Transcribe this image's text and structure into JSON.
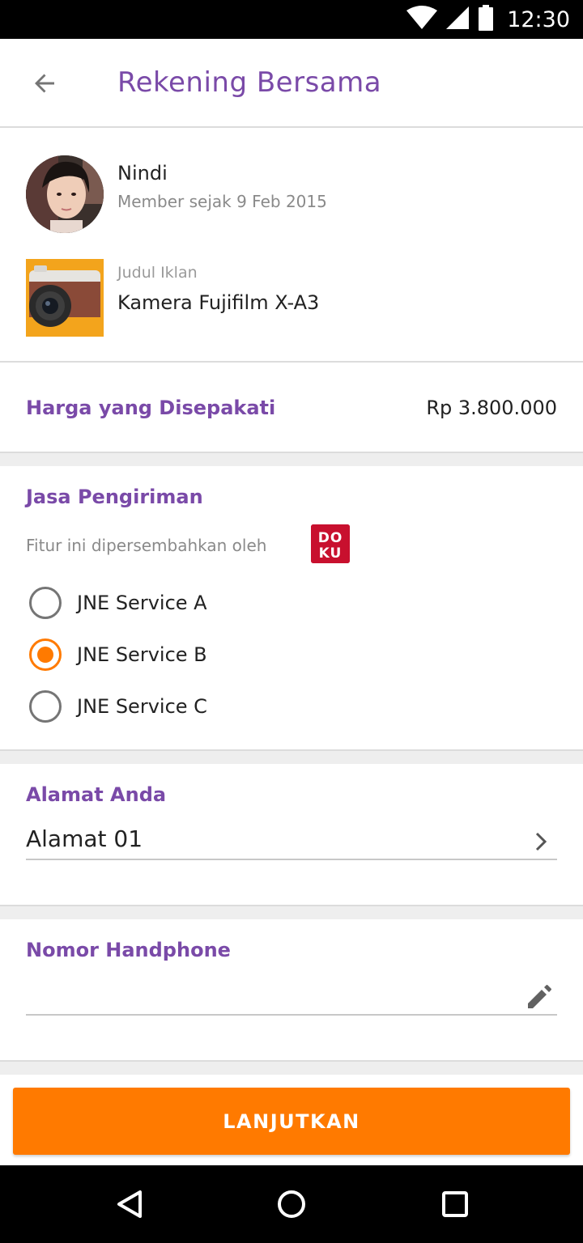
{
  "status_bar": {
    "time": "12:30"
  },
  "app_bar": {
    "title": "Rekening Bersama"
  },
  "seller": {
    "name": "Nindi",
    "member_since": "Member sejak 9 Feb 2015"
  },
  "ad": {
    "label": "Judul Iklan",
    "title": "Kamera Fujifilm X-A3"
  },
  "price": {
    "label": "Harga yang Disepakati",
    "value": "Rp 3.800.000"
  },
  "shipping": {
    "title": "Jasa Pengiriman",
    "powered_by": "Fitur ini dipersembahkan oleh",
    "provider_logo": "DOKU",
    "options": [
      {
        "label": "JNE Service A",
        "selected": false
      },
      {
        "label": "JNE Service B",
        "selected": true
      },
      {
        "label": "JNE Service C",
        "selected": false
      }
    ]
  },
  "address": {
    "title": "Alamat Anda",
    "value": "Alamat 01"
  },
  "phone": {
    "title": "Nomor Handphone",
    "value": "",
    "placeholder": ""
  },
  "continue_button": {
    "label": "LANJUTKAN"
  },
  "colors": {
    "accent": "#7a4aa8",
    "primary_button": "#ff7a00",
    "radio_selected": "#ff7a00",
    "doku_red": "#c8102e"
  }
}
